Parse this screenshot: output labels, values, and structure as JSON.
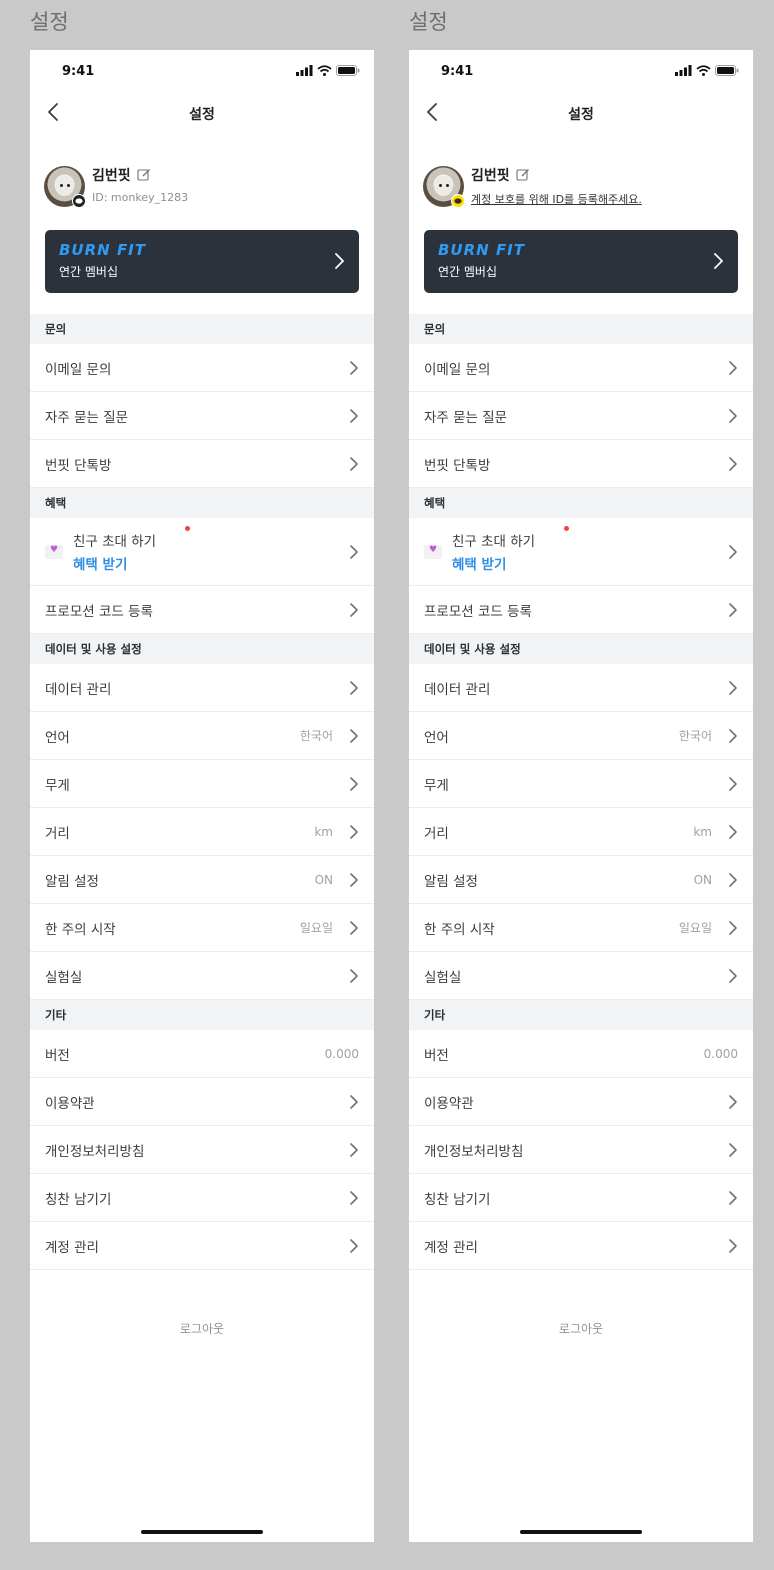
{
  "screens": [
    {
      "frame_label": "설정",
      "status_time": "9:41",
      "nav_title": "설정",
      "profile_name": "김번핏",
      "profile_sub": "ID: monkey_1283",
      "profile_sub_is_link": false,
      "badge_style": "dark"
    },
    {
      "frame_label": "설정",
      "status_time": "9:41",
      "nav_title": "설정",
      "profile_name": "김번핏",
      "profile_sub": "계정 보호를 위해 ID를 등록해주세요.",
      "profile_sub_is_link": true,
      "badge_style": "yellow"
    }
  ],
  "membership": {
    "logo": "BURN FIT",
    "plan": "연간 멤버십"
  },
  "sections": {
    "inquiry": {
      "title": "문의",
      "items": [
        "이메일 문의",
        "자주 묻는 질문",
        "번핏 단톡방"
      ]
    },
    "benefit": {
      "title": "혜택",
      "friend_line1": "친구 초대 하기",
      "friend_line2": "혜택 받기",
      "promo": "프로모션 코드 등록"
    },
    "data": {
      "title": "데이터 및 사용 설정",
      "items": [
        {
          "label": "데이터 관리",
          "value": ""
        },
        {
          "label": "언어",
          "value": "한국어"
        },
        {
          "label": "무게",
          "value": ""
        },
        {
          "label": "거리",
          "value": "km"
        },
        {
          "label": "알림 설정",
          "value": "ON"
        },
        {
          "label": "한 주의 시작",
          "value": "일요일"
        },
        {
          "label": "실험실",
          "value": ""
        }
      ]
    },
    "etc": {
      "title": "기타",
      "version_label": "버전",
      "version_value": "0.000",
      "items": [
        "이용약관",
        "개인정보처리방침",
        "칭찬 남기기",
        "계정 관리"
      ]
    }
  },
  "logout": "로그아웃",
  "colors": {
    "accent": "#2f8fe4",
    "card": "#2b323c",
    "section_bg": "#f2f3f5",
    "kakao_yellow": "#fae100"
  }
}
